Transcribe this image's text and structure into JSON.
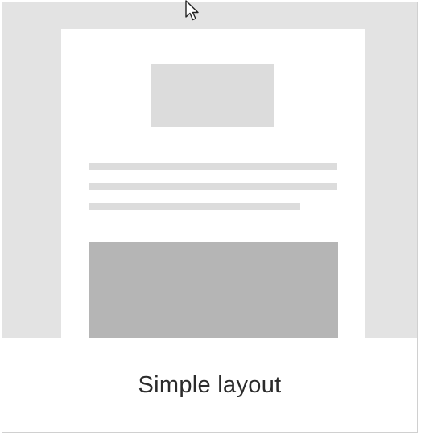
{
  "template_card": {
    "label": "Simple layout"
  },
  "cursor": {
    "icon": "mouse-pointer-icon"
  }
}
